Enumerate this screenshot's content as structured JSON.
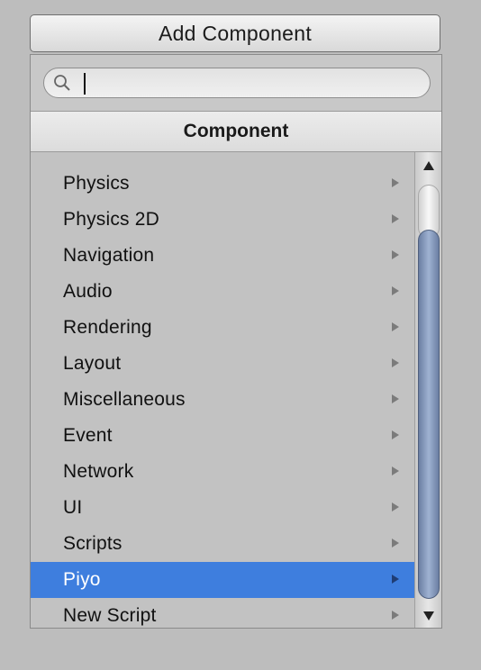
{
  "button": {
    "add_component_label": "Add Component"
  },
  "search": {
    "value": "",
    "icon": "search-icon"
  },
  "header": {
    "title": "Component"
  },
  "list": {
    "items": [
      {
        "label": "Physics",
        "has_submenu": true
      },
      {
        "label": "Physics 2D",
        "has_submenu": true
      },
      {
        "label": "Navigation",
        "has_submenu": true
      },
      {
        "label": "Audio",
        "has_submenu": true
      },
      {
        "label": "Rendering",
        "has_submenu": true
      },
      {
        "label": "Layout",
        "has_submenu": true
      },
      {
        "label": "Miscellaneous",
        "has_submenu": true
      },
      {
        "label": "Event",
        "has_submenu": true
      },
      {
        "label": "Network",
        "has_submenu": true
      },
      {
        "label": "UI",
        "has_submenu": true
      },
      {
        "label": "Scripts",
        "has_submenu": true
      },
      {
        "label": "Piyo",
        "has_submenu": true,
        "selected": true
      },
      {
        "label": "New Script",
        "has_submenu": true
      }
    ]
  },
  "colors": {
    "selection": "#3e7ede",
    "scroll_thumb": "#8093b5"
  }
}
